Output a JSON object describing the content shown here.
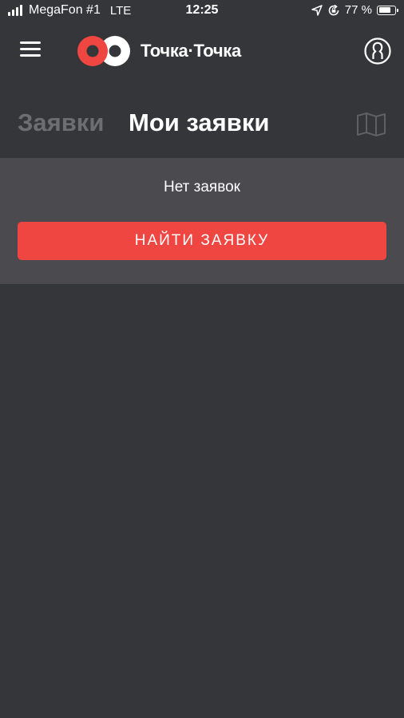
{
  "status_bar": {
    "carrier": "MegaFon #1",
    "network": "LTE",
    "time": "12:25",
    "battery_percent_label": "77 %",
    "battery_level": 0.77
  },
  "header": {
    "app_name": "Точка·Точка",
    "colors": {
      "logo_red": "#ef4642",
      "logo_white": "#ffffff"
    }
  },
  "tabs": {
    "requests_label": "Заявки",
    "my_requests_label": "Мои заявки",
    "active": "my_requests"
  },
  "content": {
    "empty_message": "Нет заявок",
    "find_button_label": "НАЙТИ ЗАЯВКУ"
  },
  "icons": {
    "menu": "hamburger-menu-icon",
    "profile": "user-profile-icon",
    "map": "map-icon",
    "location": "location-arrow-icon",
    "rotation_lock": "rotation-lock-icon"
  },
  "colors": {
    "background": "#35363a",
    "panel": "#4a4a4f",
    "accent": "#ef4642",
    "inactive_tab": "#6d6e72"
  }
}
